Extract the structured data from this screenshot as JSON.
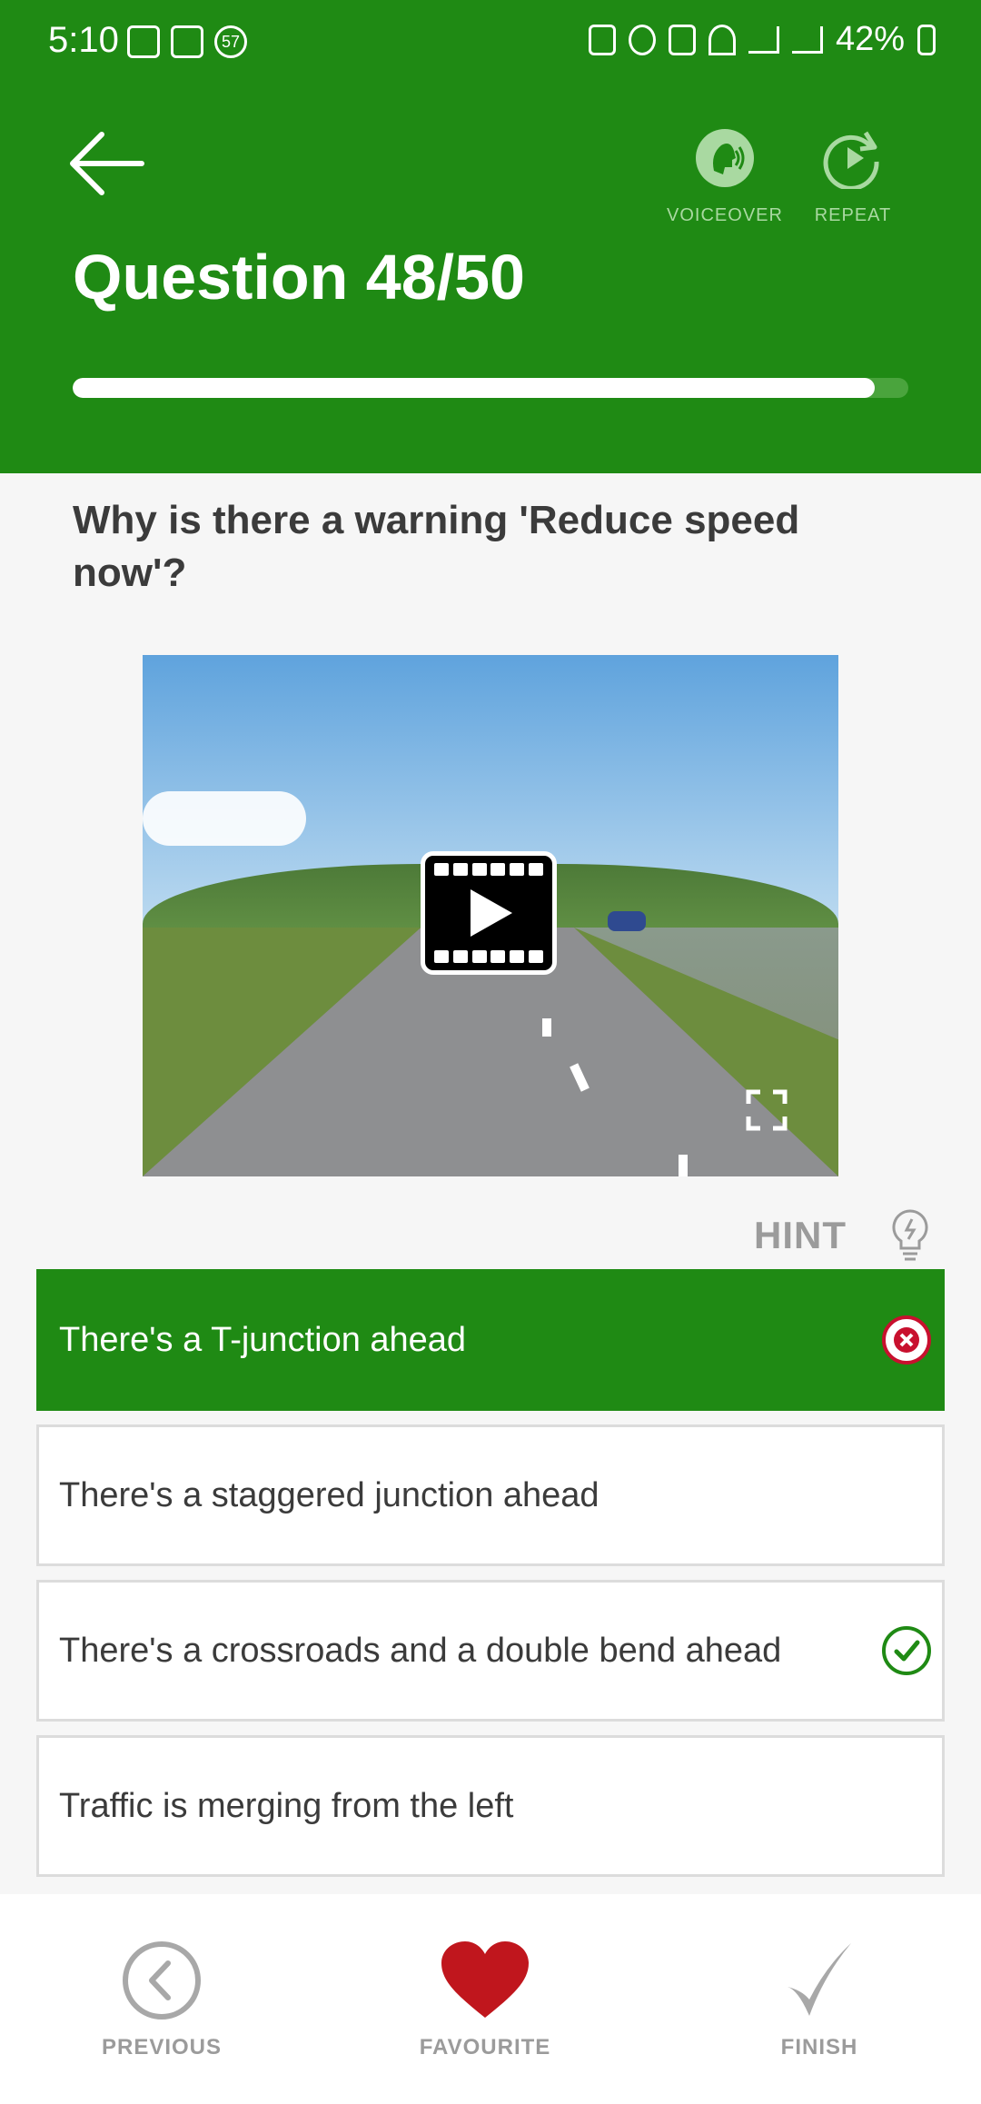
{
  "status_bar": {
    "time": "5:10",
    "badge": "57",
    "app_badge": "4 in 1",
    "battery": "42%"
  },
  "header": {
    "question_counter": "Question 48/50",
    "voiceover_label": "VOICEOVER",
    "repeat_label": "REPEAT",
    "progress_fraction": 0.96
  },
  "question": {
    "text": "Why is there a warning 'Reduce speed now'?"
  },
  "hint_label": "HINT",
  "answers": [
    {
      "text": "There's a T-junction ahead",
      "state": "selected-wrong"
    },
    {
      "text": "There's a staggered junction ahead",
      "state": "none"
    },
    {
      "text": "There's a crossroads and a double bend ahead",
      "state": "correct"
    },
    {
      "text": "Traffic is merging from the left",
      "state": "none"
    }
  ],
  "bottom_nav": {
    "previous": "PREVIOUS",
    "favourite": "FAVOURITE",
    "finish": "FINISH"
  },
  "colors": {
    "brand_green": "#1f8a14",
    "favourite_red": "#c0161d",
    "wrong_red": "#c8102e"
  }
}
